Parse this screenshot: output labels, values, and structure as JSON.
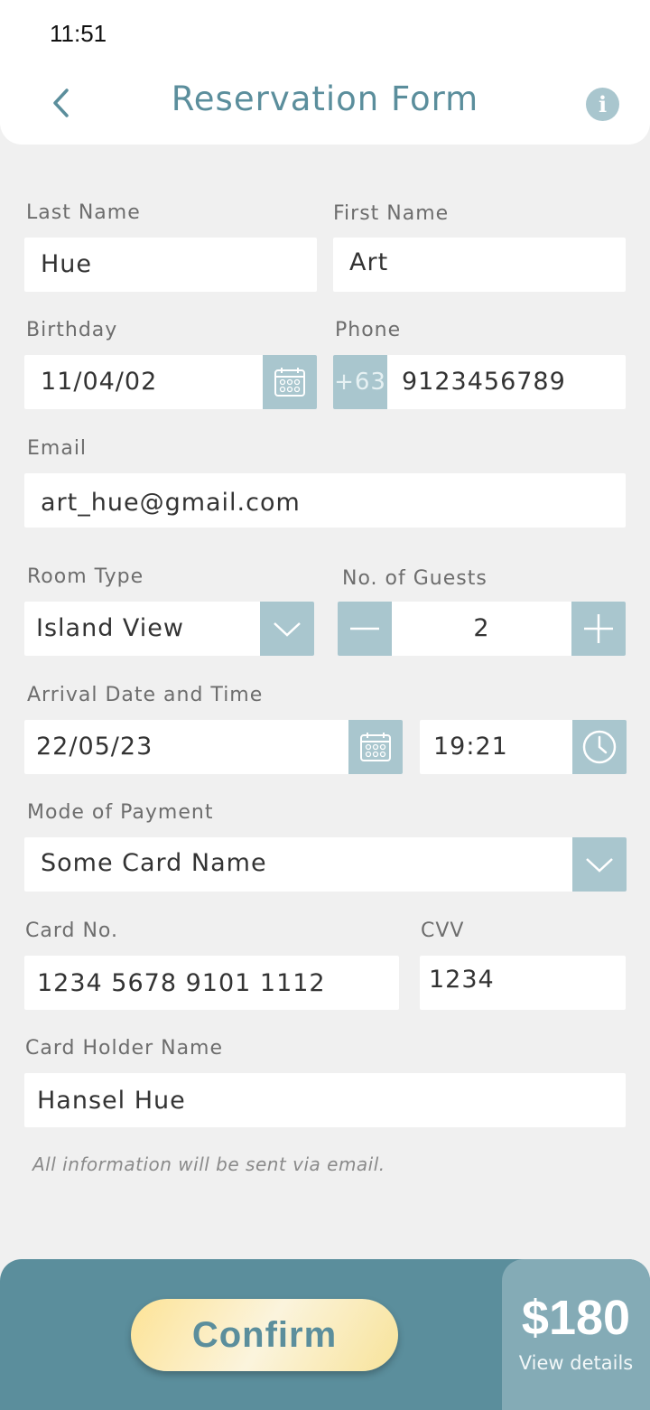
{
  "status_bar": {
    "time": "11:51"
  },
  "header": {
    "title": "Reservation Form",
    "info_symbol": "i",
    "back_icon": "chevron-left-icon"
  },
  "form": {
    "last_name": {
      "label": "Last Name",
      "value": "Hue"
    },
    "first_name": {
      "label": "First Name",
      "value": "Art"
    },
    "birthday": {
      "label": "Birthday",
      "value": "11/04/02"
    },
    "phone": {
      "label": "Phone",
      "prefix": "+63",
      "value": "9123456789"
    },
    "email": {
      "label": "Email",
      "value": "art_hue@gmail.com"
    },
    "room_type": {
      "label": "Room Type",
      "value": "Island View"
    },
    "guests": {
      "label": "No. of Guests",
      "value": "2"
    },
    "arrival": {
      "label": "Arrival Date and Time",
      "date": "22/05/23",
      "time": "19:21"
    },
    "payment": {
      "label": "Mode of Payment",
      "value": "Some Card Name"
    },
    "card_no": {
      "label": "Card No.",
      "value": "1234 5678 9101 1112"
    },
    "cvv": {
      "label": "CVV",
      "value": "1234"
    },
    "card_holder": {
      "label": "Card Holder Name",
      "value": "Hansel Hue"
    },
    "note": "All information will be sent via email."
  },
  "footer": {
    "confirm_label": "Confirm",
    "price": "$180",
    "view_details": "View details"
  },
  "colors": {
    "accent": "#5b8e9c",
    "addon": "#a9c6ce",
    "background": "#f0f0f0",
    "button": "#fde396"
  }
}
